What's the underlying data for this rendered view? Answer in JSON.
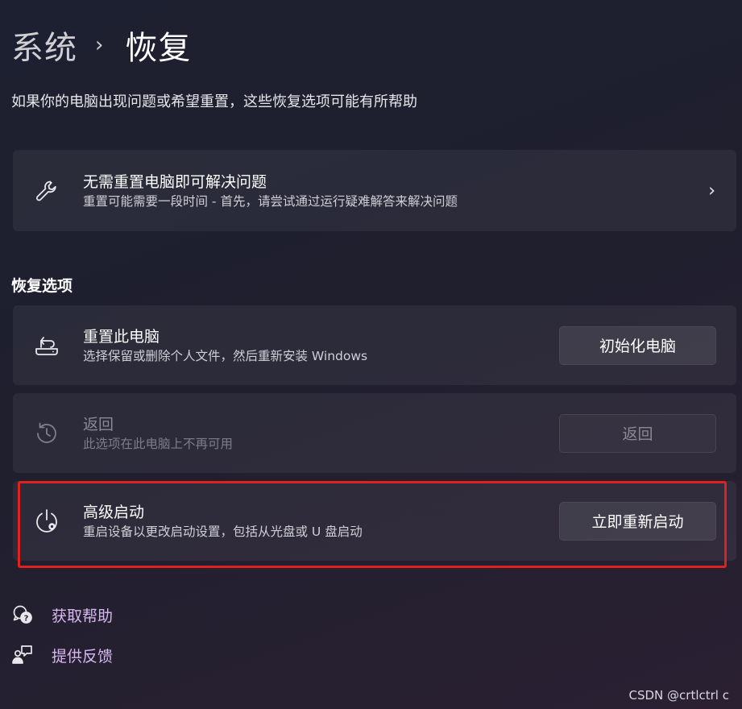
{
  "header": {
    "parent": "系统",
    "separator": "›",
    "current": "恢复"
  },
  "subtitle": "如果你的电脑出现问题或希望重置，这些恢复选项可能有所帮助",
  "troubleshoot_card": {
    "icon": "wrench-icon",
    "title": "无需重置电脑即可解决问题",
    "description": "重置可能需要一段时间 - 首先，请尝试通过运行疑难解答来解决问题",
    "chevron": "›"
  },
  "recovery_section": {
    "label": "恢复选项",
    "items": [
      {
        "icon": "reset-pc-icon",
        "title": "重置此电脑",
        "description": "选择保留或删除个人文件，然后重新安装 Windows",
        "button": "初始化电脑",
        "enabled": true
      },
      {
        "icon": "history-icon",
        "title": "返回",
        "description": "此选项在此电脑上不再可用",
        "button": "返回",
        "enabled": false
      },
      {
        "icon": "advanced-startup-icon",
        "title": "高级启动",
        "description": "重启设备以更改启动设置，包括从光盘或 U 盘启动",
        "button": "立即重新启动",
        "enabled": true
      }
    ]
  },
  "links": [
    {
      "icon": "get-help-icon",
      "label": "获取帮助"
    },
    {
      "icon": "feedback-icon",
      "label": "提供反馈"
    }
  ],
  "watermark": "CSDN @crtlctrl c",
  "colors": {
    "link": "#d9b8f2",
    "highlight": "#e0221e",
    "background": "#1f1f2e"
  }
}
